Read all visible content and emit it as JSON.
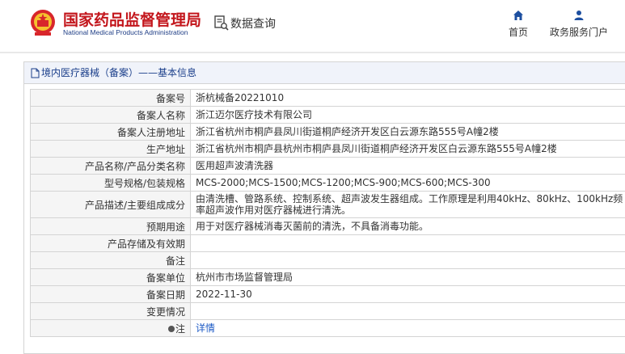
{
  "header": {
    "logo_cn": "国家药品监督管理局",
    "logo_en": "National Medical Products Administration",
    "query_label": "数据查询",
    "nav": [
      {
        "label": "首页",
        "icon": "home-icon"
      },
      {
        "label": "政务服务门户",
        "icon": "user-icon"
      }
    ]
  },
  "panel": {
    "title": "境内医疗器械（备案）——基本信息"
  },
  "rows": [
    {
      "label": "备案号",
      "value": "浙杭械备20221010"
    },
    {
      "label": "备案人名称",
      "value": "浙江迈尔医疗技术有限公司"
    },
    {
      "label": "备案人注册地址",
      "value": "浙江省杭州市桐庐县凤川街道桐庐经济开发区白云源东路555号A幢2楼"
    },
    {
      "label": "生产地址",
      "value": "浙江省杭州市桐庐县杭州市桐庐县凤川街道桐庐经济开发区白云源东路555号A幢2楼"
    },
    {
      "label": "产品名称/产品分类名称",
      "value": "医用超声波清洗器"
    },
    {
      "label": "型号规格/包装规格",
      "value": "MCS-2000;MCS-1500;MCS-1200;MCS-900;MCS-600;MCS-300"
    },
    {
      "label": "产品描述/主要组成成分",
      "value": "由清洗槽、管路系统、控制系统、超声波发生器组成。工作原理是利用40kHz、80kHz、100kHz频率超声波作用对医疗器械进行清洗。"
    },
    {
      "label": "预期用途",
      "value": "用于对医疗器械消毒灭菌前的清洗，不具备消毒功能。"
    },
    {
      "label": "产品存储及有效期",
      "value": ""
    },
    {
      "label": "备注",
      "value": ""
    },
    {
      "label": "备案单位",
      "value": "杭州市市场监督管理局"
    },
    {
      "label": "备案日期",
      "value": "2022-11-30"
    },
    {
      "label": "变更情况",
      "value": ""
    },
    {
      "label": "注",
      "value": "详情"
    }
  ],
  "colors": {
    "brand_red": "#c3161c",
    "brand_blue": "#1f3e86",
    "link": "#1e5bc6"
  }
}
